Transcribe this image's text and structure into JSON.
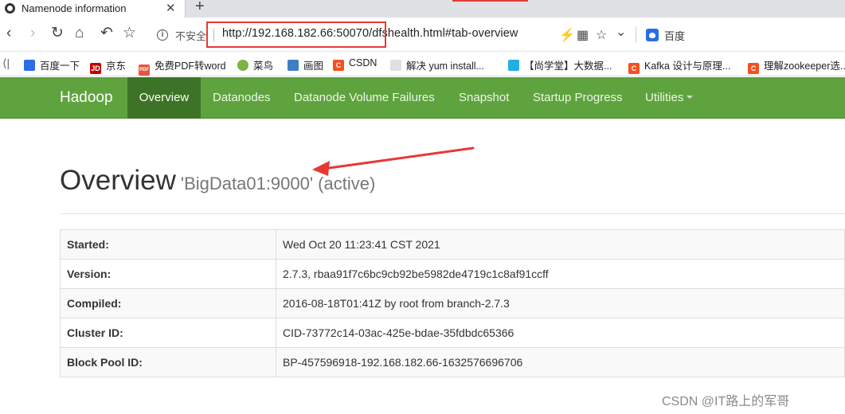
{
  "browser": {
    "tab_title": "Namenode information",
    "tab_close_glyph": "✕",
    "new_tab_glyph": "+",
    "nav": {
      "back_glyph": "‹",
      "forward_glyph": "›",
      "reload_glyph": "↻",
      "home_glyph": "⌂",
      "undo_glyph": "↶",
      "star_glyph": "☆"
    },
    "security_label": "不安全",
    "url": "http://192.168.182.66:50070/dfshealth.html#tab-overview",
    "right_glyphs": {
      "bolt": "⚡",
      "grid": "▦",
      "star": "☆",
      "chevron": "⌄"
    },
    "search_engine_label": "百度",
    "annotation_color": "#e53935"
  },
  "bookmarks": [
    {
      "label": "百度一下",
      "icon": "baidu-icon",
      "color": "#2b6de6",
      "glyph": ""
    },
    {
      "label": "京东",
      "icon": "jd-icon",
      "color": "#c40000",
      "glyph": "JD"
    },
    {
      "label": "免费PDF转word",
      "icon": "pdf-icon",
      "color": "#e8553f",
      "glyph": "PDF"
    },
    {
      "label": "菜鸟",
      "icon": "runoob-icon",
      "color": "#7cb342",
      "glyph": ""
    },
    {
      "label": "画图",
      "icon": "diagram-icon",
      "color": "#3f7ec4",
      "glyph": ""
    },
    {
      "label": "CSDN",
      "icon": "csdn-icon",
      "color": "#f4511e",
      "glyph": "C"
    },
    {
      "label": "解决 yum install...",
      "icon": "generic-page-icon",
      "color": "#9e9e9e",
      "glyph": ""
    },
    {
      "label": "【尚学堂】大数据...",
      "icon": "bilibili-icon",
      "color": "#23ade5",
      "glyph": ""
    },
    {
      "label": "Kafka 设计与原理...",
      "icon": "csdn-icon",
      "color": "#f4511e",
      "glyph": "C"
    },
    {
      "label": "理解zookeeper选...",
      "icon": "csdn-icon",
      "color": "#f4511e",
      "glyph": "C"
    }
  ],
  "navbar": {
    "brand": "Hadoop",
    "color": "#5fa33e",
    "active_color": "#3d7326",
    "items": [
      {
        "label": "Overview",
        "active": true
      },
      {
        "label": "Datanodes",
        "active": false
      },
      {
        "label": "Datanode Volume Failures",
        "active": false
      },
      {
        "label": "Snapshot",
        "active": false
      },
      {
        "label": "Startup Progress",
        "active": false
      },
      {
        "label": "Utilities",
        "active": false
      }
    ]
  },
  "header": {
    "title": "Overview",
    "subtitle": "'BigData01:9000' (active)"
  },
  "overview_table": [
    {
      "key": "Started:",
      "value": "Wed Oct 20 11:23:41 CST 2021"
    },
    {
      "key": "Version:",
      "value": "2.7.3, rbaa91f7c6bc9cb92be5982de4719c1c8af91ccff"
    },
    {
      "key": "Compiled:",
      "value": "2016-08-18T01:41Z by root from branch-2.7.3"
    },
    {
      "key": "Cluster ID:",
      "value": "CID-73772c14-03ac-425e-bdae-35fdbdc65366"
    },
    {
      "key": "Block Pool ID:",
      "value": "BP-457596918-192.168.182.66-1632576696706"
    }
  ],
  "watermark": "CSDN @IT路上的军哥"
}
